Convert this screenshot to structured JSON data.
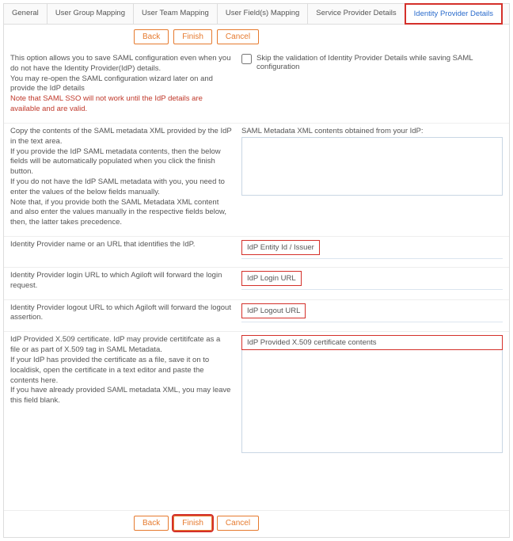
{
  "tabs": {
    "general": "General",
    "user_group_mapping": "User Group Mapping",
    "user_team_mapping": "User Team Mapping",
    "user_fields_mapping": "User Field(s) Mapping",
    "service_provider_details": "Service Provider Details",
    "identity_provider_details": "Identity Provider Details"
  },
  "buttons": {
    "back": "Back",
    "finish": "Finish",
    "cancel": "Cancel"
  },
  "intro": {
    "line1": "This option allows you to save SAML configuration even when you do not have the Identity Provider(IdP) details.",
    "line2": "You may re-open the SAML configuration wizard later on and provide the IdP details",
    "warn": "Note that SAML SSO will not work until the IdP details are available and are valid."
  },
  "skip_validation": {
    "label": "Skip the validation of Identity Provider Details while saving SAML configuration"
  },
  "metadata": {
    "instr1": "Copy the contents of the SAML metadata XML provided by the IdP in the text area.",
    "instr2": "If you provide the IdP SAML metadata contents, then the below fields will be automatically populated when you click the finish button.",
    "instr3": "If you do not have the IdP SAML metadata with you, you need to enter the values of the below fields manually.",
    "instr4": "Note that, if you provide both the SAML Metadata XML content and also enter the values manually in the respective fields below, then, the latter takes precedence.",
    "right_label": "SAML Metadata XML contents obtained from your IdP:"
  },
  "fields": {
    "entity": {
      "desc": "Identity Provider name or an URL that identifies the IdP.",
      "value": "IdP Entity Id / Issuer"
    },
    "login": {
      "desc": "Identity Provider login URL to which Agiloft will forward the login request.",
      "value": "IdP Login URL"
    },
    "logout": {
      "desc": "Identity Provider logout URL to which Agiloft will forward the logout assertion.",
      "value": "IdP Logout URL"
    },
    "cert": {
      "desc1": "IdP Provided X.509 certificate. IdP may provide certitifcate as a file or as part of X.509 tag in SAML Metadata.",
      "desc2": "If your IdP has provided the certificate as a file, save it on to localdisk, open the certificate in a text editor and paste the contents here.",
      "desc3": "If you have already provided SAML metadata XML, you may leave this field blank.",
      "value": "IdP Provided X.509 certificate contents"
    }
  }
}
